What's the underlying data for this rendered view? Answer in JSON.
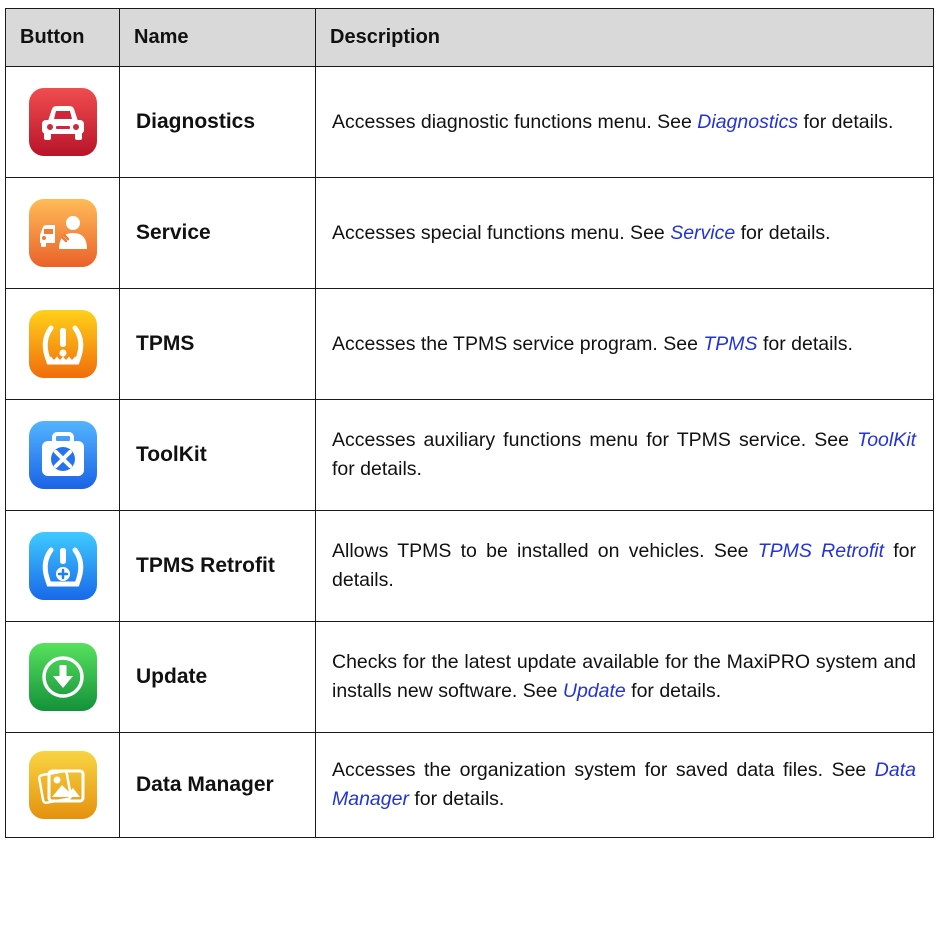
{
  "header": {
    "button": "Button",
    "name": "Name",
    "description": "Description"
  },
  "rows": [
    {
      "icon": "car-icon",
      "color": "#d62b3c",
      "name": "Diagnostics",
      "desc_before": "Accesses diagnostic functions menu. See ",
      "link": "Diagnostics",
      "desc_after": " for details."
    },
    {
      "icon": "car-service-person-icon",
      "color": "#f28a3a",
      "name": "Service",
      "desc_before": "Accesses special functions menu. See ",
      "link": "Service",
      "desc_after": " for details."
    },
    {
      "icon": "tire-pressure-warning-icon",
      "color": "#f7981a",
      "name": "TPMS",
      "desc_before": "Accesses the TPMS service program. See ",
      "link": "TPMS",
      "desc_after": " for details."
    },
    {
      "icon": "toolbox-icon",
      "color": "#2f86f2",
      "name": "ToolKit",
      "desc_before": "Accesses auxiliary functions menu for TPMS service. See ",
      "link": "ToolKit",
      "desc_after": " for details."
    },
    {
      "icon": "tire-pressure-plus-icon",
      "color": "#2a94f2",
      "name": "TPMS Retrofit",
      "desc_before": "Allows TPMS to be installed on vehicles. See ",
      "link": "TPMS Retrofit",
      "desc_after": " for details."
    },
    {
      "icon": "download-arrow-icon",
      "color": "#2fb548",
      "name": "Update",
      "desc_before": "Checks for the latest update available for the MaxiPRO system and installs new software. See ",
      "link": "Update",
      "desc_after": " for details."
    },
    {
      "icon": "photo-folder-icon",
      "color": "#f0ad25",
      "name": "Data Manager",
      "desc_before": "Accesses the organization system for saved data files. See ",
      "link": "Data Manager",
      "desc_after": " for details."
    }
  ]
}
